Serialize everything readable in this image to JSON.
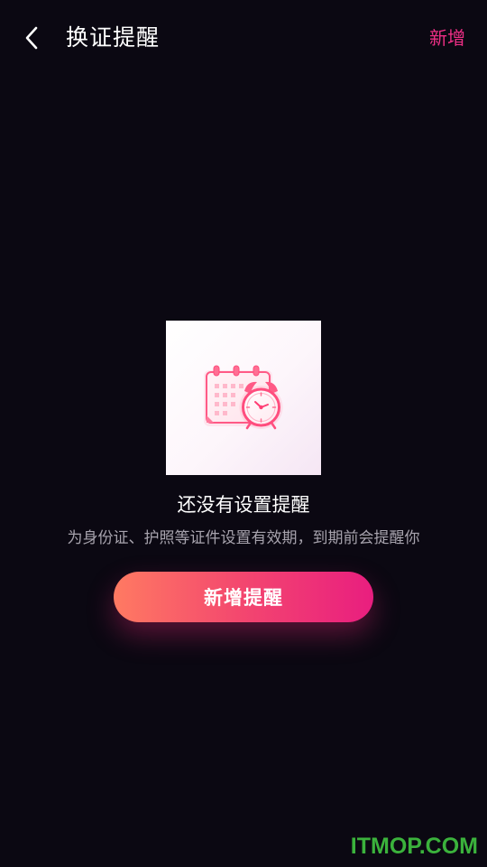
{
  "header": {
    "title": "换证提醒",
    "add_label": "新增"
  },
  "empty_state": {
    "title": "还没有设置提醒",
    "description": "为身份证、护照等证件设置有效期，到期前会提醒你",
    "button_label": "新增提醒"
  },
  "watermark": {
    "text": "ITMOP.COM"
  },
  "icons": {
    "back": "chevron-left-icon",
    "illustration": "calendar-alarm-clock-illustration"
  },
  "colors": {
    "background": "#0b0812",
    "accent": "#ef2f86",
    "button_start": "#ff7a62",
    "button_end": "#e91e7f",
    "muted_text": "#a7a3ad",
    "watermark": "#3bb23c"
  }
}
